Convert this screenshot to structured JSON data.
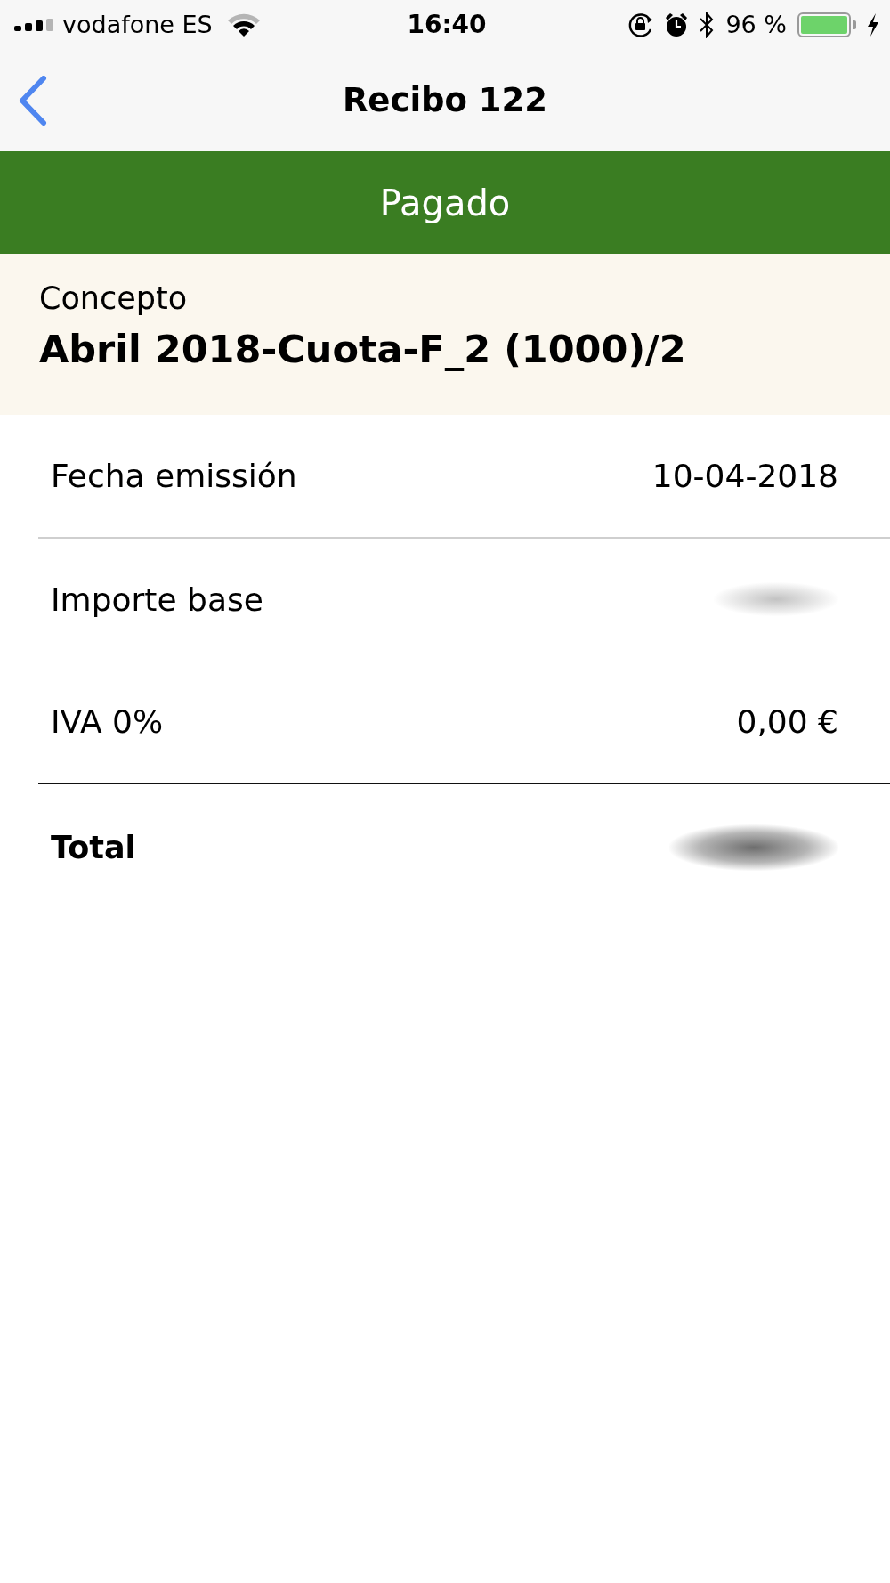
{
  "status_bar": {
    "carrier": "vodafone ES",
    "time": "16:40",
    "battery": "96 %"
  },
  "nav_bar": {
    "title": "Recibo 122"
  },
  "status_banner": {
    "label": "Pagado"
  },
  "concept": {
    "label": "Concepto",
    "value": "Abril 2018-Cuota-F_2 (1000)/2"
  },
  "details": [
    {
      "label": "Fecha emissión",
      "value": "10-04-2018",
      "blurred": false
    },
    {
      "label": "Importe base",
      "blurred": true
    },
    {
      "label": "IVA 0%",
      "value": "0,00 €",
      "blurred": false
    }
  ],
  "total": {
    "label": "Total",
    "blurred": true
  }
}
